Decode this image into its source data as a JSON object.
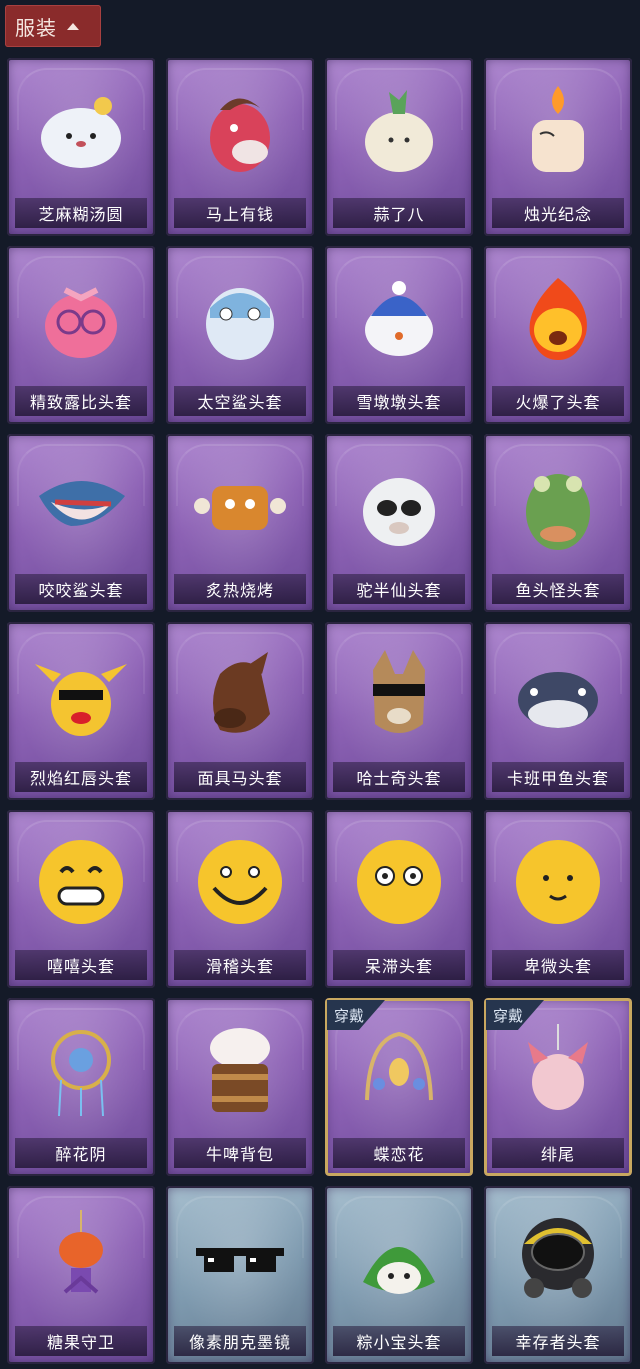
{
  "section": {
    "label": "服装",
    "expand_icon": "chevron-up-icon"
  },
  "items": [
    {
      "label": "芝麻糊汤圆",
      "icon": "rice-ball-icon",
      "bg": "purple"
    },
    {
      "label": "马上有钱",
      "icon": "horse-mask-icon",
      "bg": "purple"
    },
    {
      "label": "蒜了八",
      "icon": "garlic-icon",
      "bg": "purple"
    },
    {
      "label": "烛光纪念",
      "icon": "candle-icon",
      "bg": "purple"
    },
    {
      "label": "精致露比头套",
      "icon": "pink-beaver-icon",
      "bg": "purple"
    },
    {
      "label": "太空鲨头套",
      "icon": "space-shark-icon",
      "bg": "purple"
    },
    {
      "label": "雪墩墩头套",
      "icon": "snowman-icon",
      "bg": "purple"
    },
    {
      "label": "火爆了头套",
      "icon": "fire-spirit-icon",
      "bg": "purple"
    },
    {
      "label": "咬咬鲨头套",
      "icon": "shark-icon",
      "bg": "purple"
    },
    {
      "label": "炙热烧烤",
      "icon": "bbq-meat-icon",
      "bg": "purple"
    },
    {
      "label": "驼半仙头套",
      "icon": "alpaca-sunglasses-icon",
      "bg": "purple"
    },
    {
      "label": "鱼头怪头套",
      "icon": "fish-head-icon",
      "bg": "purple"
    },
    {
      "label": "烈焰红唇头套",
      "icon": "yellow-mouse-icon",
      "bg": "purple"
    },
    {
      "label": "面具马头套",
      "icon": "horse-head-icon",
      "bg": "purple"
    },
    {
      "label": "哈士奇头套",
      "icon": "husky-icon",
      "bg": "purple"
    },
    {
      "label": "卡班甲鱼头套",
      "icon": "catfish-icon",
      "bg": "purple"
    },
    {
      "label": "嘻嘻头套",
      "icon": "grin-emoji-icon",
      "bg": "purple"
    },
    {
      "label": "滑稽头套",
      "icon": "funny-emoji-icon",
      "bg": "purple"
    },
    {
      "label": "呆滞头套",
      "icon": "blank-emoji-icon",
      "bg": "purple"
    },
    {
      "label": "卑微头套",
      "icon": "humble-emoji-icon",
      "bg": "purple"
    },
    {
      "label": "醉花阴",
      "icon": "flower-hairpin-icon",
      "bg": "purple"
    },
    {
      "label": "牛啤背包",
      "icon": "beer-cow-backpack-icon",
      "bg": "purple"
    },
    {
      "label": "蝶恋花",
      "icon": "butterfly-crown-icon",
      "bg": "purple",
      "badge": "穿戴"
    },
    {
      "label": "绯尾",
      "icon": "fox-pendant-icon",
      "bg": "purple",
      "badge": "穿戴"
    },
    {
      "label": "糖果守卫",
      "icon": "pumpkin-doll-icon",
      "bg": "purple"
    },
    {
      "label": "像素朋克墨镜",
      "icon": "pixel-sunglasses-icon",
      "bg": "blue"
    },
    {
      "label": "粽小宝头套",
      "icon": "zongzi-icon",
      "bg": "blue"
    },
    {
      "label": "幸存者头套",
      "icon": "gas-mask-icon",
      "bg": "blue"
    }
  ]
}
